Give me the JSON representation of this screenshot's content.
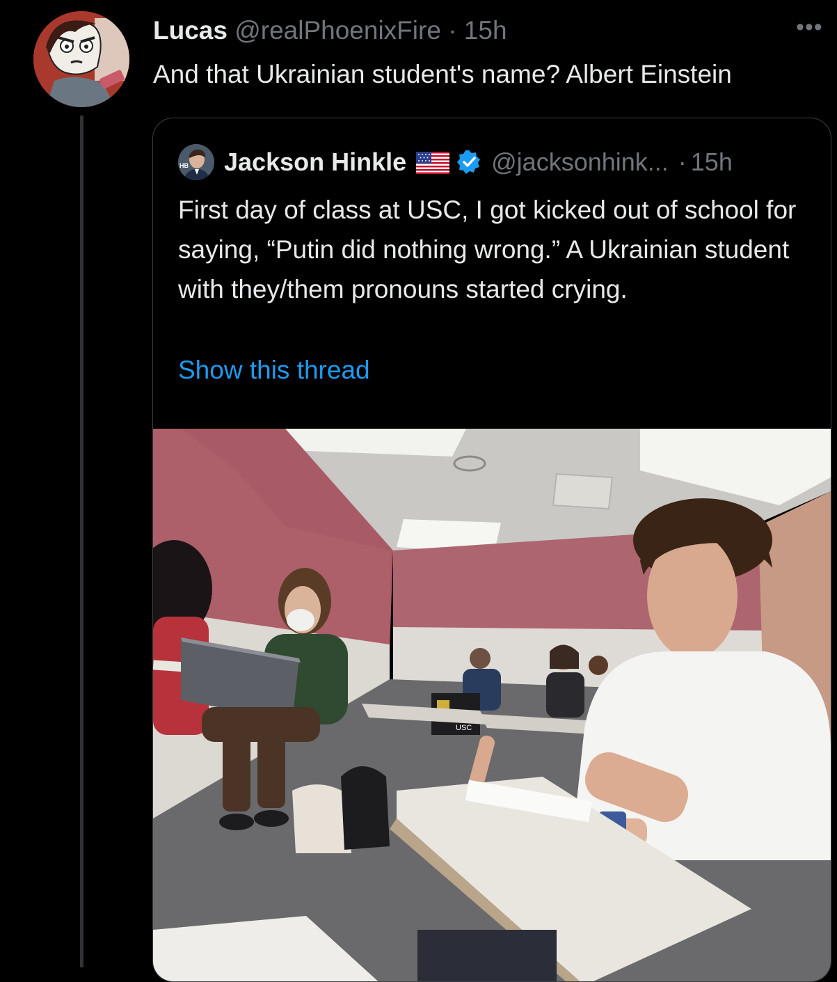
{
  "reply": {
    "display_name": "Lucas",
    "handle": "@realPhoenixFire",
    "separator": "·",
    "time": "15h",
    "more_glyph": "•••",
    "text": "And that Ukrainian student's name? Albert Einstein"
  },
  "quote": {
    "display_name": "Jackson Hinkle",
    "avatar_initials": "HB",
    "handle": "@jacksonhink...",
    "separator": "·",
    "time": "15h",
    "text": "First day of class at USC, I got kicked out of school for saying, “Putin did nothing wrong.” A Ukrainian student with they/them pronouns started crying.",
    "show_thread": "Show this thread",
    "media": {
      "description_icon": "classroom-photo",
      "laptop_sticker": "USC"
    }
  },
  "colors": {
    "background": "#000000",
    "text_primary": "#e7e9ea",
    "text_secondary": "#71767b",
    "link": "#1d9bf0",
    "border": "#3b4045",
    "verified": "#1d9bf0"
  }
}
